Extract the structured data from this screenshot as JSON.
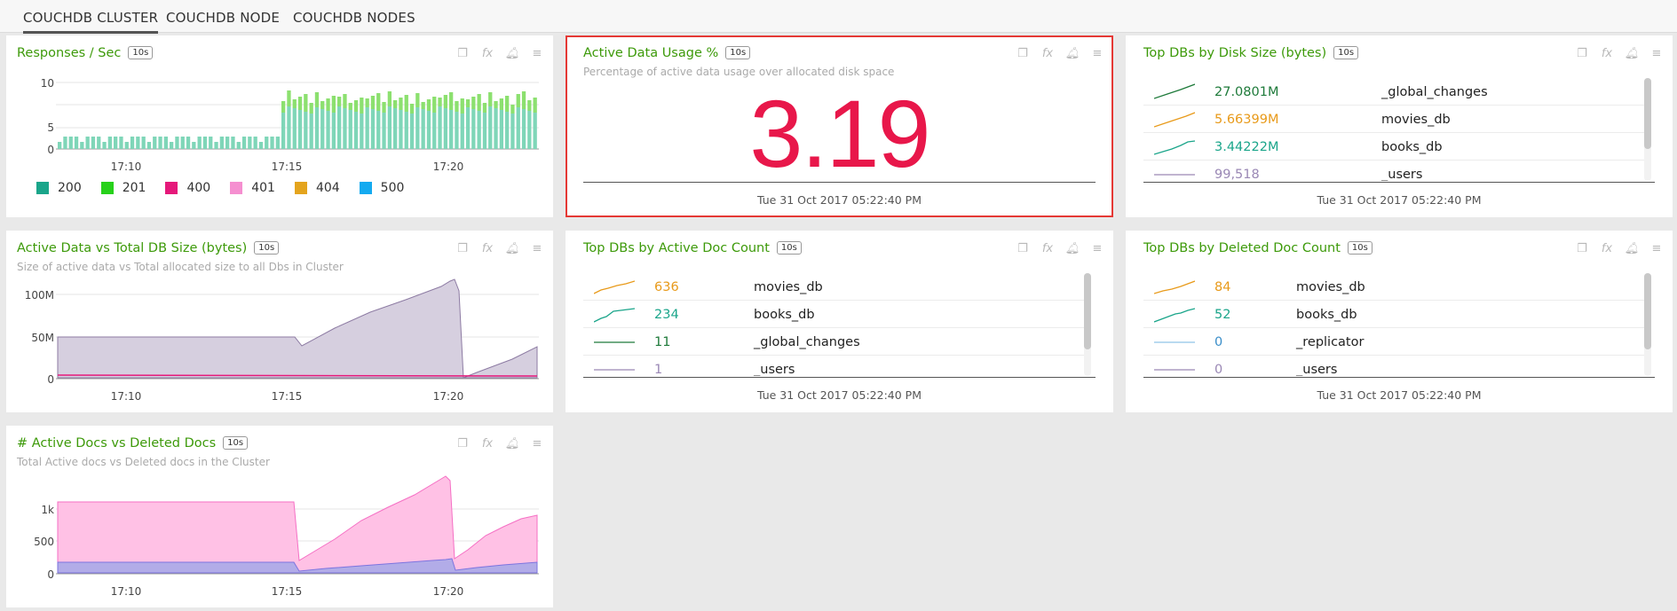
{
  "tabs": [
    "COUCHDB CLUSTER",
    "COUCHDB NODE",
    "COUCHDB NODES"
  ],
  "badge": "10s",
  "colors": {
    "title": "#3d9a0a",
    "accent": "#e8174a",
    "area_total": "#d6cfdf",
    "area_active": "#ff9dd6",
    "area_deleted": "#a9a2ef"
  },
  "panels": {
    "responses": {
      "title": "Responses / Sec",
      "yticks": [
        "10",
        "5",
        "0"
      ],
      "xticks": [
        "17:10",
        "17:15",
        "17:20"
      ],
      "legend": [
        {
          "label": "200",
          "color": "#1aa58a"
        },
        {
          "label": "201",
          "color": "#27d11a"
        },
        {
          "label": "400",
          "color": "#e5187a"
        },
        {
          "label": "401",
          "color": "#f58fd0"
        },
        {
          "label": "404",
          "color": "#e4a41d"
        },
        {
          "label": "500",
          "color": "#14aaf0"
        }
      ]
    },
    "usage": {
      "title": "Active Data Usage %",
      "subtitle": "Percentage of active data usage over allocated disk space",
      "value": "3.19",
      "timestamp": "Tue 31 Oct 2017 05:22:40 PM"
    },
    "disk": {
      "title": "Top DBs by Disk Size (bytes)",
      "timestamp": "Tue 31 Oct 2017 05:22:40 PM",
      "rows": [
        {
          "value": "27.0801M",
          "name": "_global_changes",
          "color": "#1e7a3a"
        },
        {
          "value": "5.66399M",
          "name": "movies_db",
          "color": "#e89a1a"
        },
        {
          "value": "3.44222M",
          "name": "books_db",
          "color": "#1aa58a"
        },
        {
          "value": "99,518",
          "name": "_users",
          "color": "#9a88b5"
        }
      ]
    },
    "dbsize": {
      "title": "Active Data vs Total DB Size (bytes)",
      "subtitle": "Size of active data vs Total allocated size to all Dbs in Cluster",
      "yticks": [
        "100M",
        "50M",
        "0"
      ],
      "xticks": [
        "17:10",
        "17:15",
        "17:20"
      ]
    },
    "activedocs": {
      "title": "Top DBs by Active Doc Count",
      "timestamp": "Tue 31 Oct 2017 05:22:40 PM",
      "rows": [
        {
          "value": "636",
          "name": "movies_db",
          "color": "#e89a1a"
        },
        {
          "value": "234",
          "name": "books_db",
          "color": "#1aa58a"
        },
        {
          "value": "11",
          "name": "_global_changes",
          "color": "#1e7a3a"
        },
        {
          "value": "1",
          "name": "_users",
          "color": "#9a88b5"
        }
      ]
    },
    "deleteddocs": {
      "title": "Top DBs by Deleted Doc Count",
      "timestamp": "Tue 31 Oct 2017 05:22:40 PM",
      "rows": [
        {
          "value": "84",
          "name": "movies_db",
          "color": "#e89a1a"
        },
        {
          "value": "52",
          "name": "books_db",
          "color": "#1aa58a"
        },
        {
          "value": "0",
          "name": "_replicator",
          "color": "#3a8ec9"
        },
        {
          "value": "0",
          "name": "_users",
          "color": "#9a88b5"
        }
      ]
    },
    "docs": {
      "title": "# Active Docs vs Deleted Docs",
      "subtitle": "Total Active docs vs Deleted docs in the Cluster",
      "yticks": [
        "1k",
        "500",
        "0"
      ],
      "xticks": [
        "17:10",
        "17:15",
        "17:20"
      ]
    }
  }
}
